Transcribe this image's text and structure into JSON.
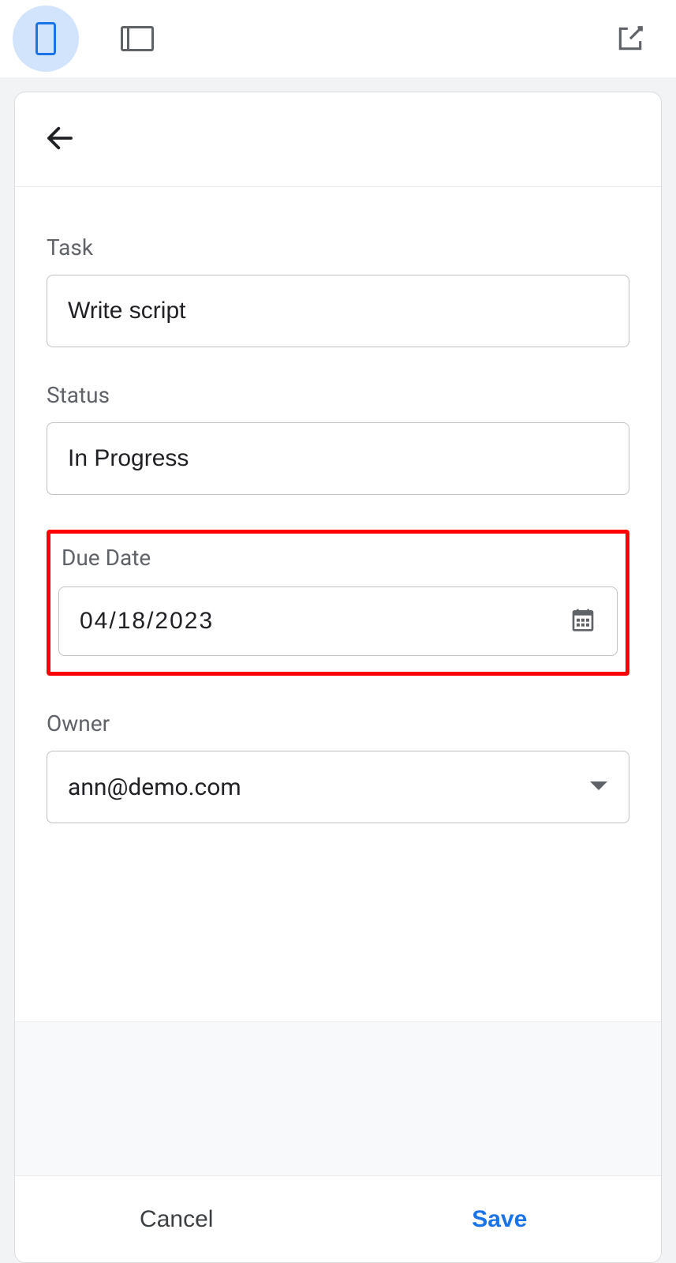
{
  "toolbar": {
    "mobile_view_active": true
  },
  "form": {
    "task": {
      "label": "Task",
      "value": "Write script"
    },
    "status": {
      "label": "Status",
      "value": "In Progress"
    },
    "due_date": {
      "label": "Due Date",
      "value": "04/18/2023"
    },
    "owner": {
      "label": "Owner",
      "value": "ann@demo.com"
    }
  },
  "footer": {
    "cancel_label": "Cancel",
    "save_label": "Save"
  }
}
